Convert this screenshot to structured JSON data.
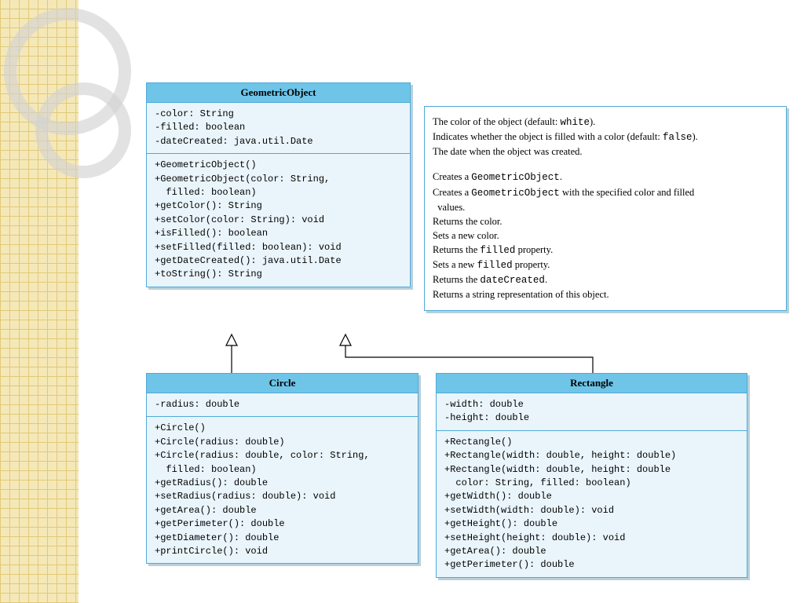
{
  "classes": {
    "geometric": {
      "name": "GeometricObject",
      "attrs": "-color: String\n-filled: boolean\n-dateCreated: java.util.Date",
      "methods": "+GeometricObject()\n+GeometricObject(color: String,\n  filled: boolean)\n+getColor(): String\n+setColor(color: String): void\n+isFilled(): boolean\n+setFilled(filled: boolean): void\n+getDateCreated(): java.util.Date\n+toString(): String"
    },
    "circle": {
      "name": "Circle",
      "attrs": "-radius: double",
      "methods": "+Circle()\n+Circle(radius: double)\n+Circle(radius: double, color: String,\n  filled: boolean)\n+getRadius(): double\n+setRadius(radius: double): void\n+getArea(): double\n+getPerimeter(): double\n+getDiameter(): double\n+printCircle(): void"
    },
    "rectangle": {
      "name": "Rectangle",
      "attrs": "-width: double\n-height: double",
      "methods": "+Rectangle()\n+Rectangle(width: double, height: double)\n+Rectangle(width: double, height: double\n  color: String, filled: boolean)\n+getWidth(): double\n+setWidth(width: double): void\n+getHeight(): double\n+setHeight(height: double): void\n+getArea(): double\n+getPerimeter(): double"
    }
  },
  "descriptions": {
    "attrs": [
      {
        "pre": "The color of the object (default: ",
        "code": "white",
        "post": ")."
      },
      {
        "pre": "Indicates whether the object is filled with a color (default: ",
        "code": "false",
        "post": ")."
      },
      {
        "pre": "The date when the object was created.",
        "code": "",
        "post": ""
      }
    ],
    "methods": [
      {
        "pre": "Creates a ",
        "code": "GeometricObject",
        "post": "."
      },
      {
        "pre": "Creates a ",
        "code": "GeometricObject",
        "post": " with the specified color and filled\n  values."
      },
      {
        "pre": "Returns the color.",
        "code": "",
        "post": ""
      },
      {
        "pre": "Sets a new color.",
        "code": "",
        "post": ""
      },
      {
        "pre": "Returns the ",
        "code": "filled",
        "post": " property."
      },
      {
        "pre": "Sets a new ",
        "code": "filled",
        "post": " property."
      },
      {
        "pre": "Returns the ",
        "code": "dateCreated",
        "post": "."
      },
      {
        "pre": "Returns a string representation of this object.",
        "code": "",
        "post": ""
      }
    ]
  }
}
